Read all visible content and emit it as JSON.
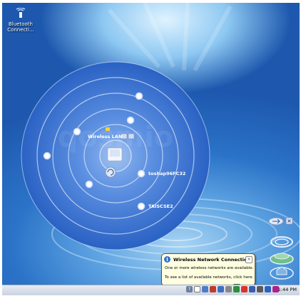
{
  "desktop": {
    "icon_label_line1": "Bluetooth",
    "icon_label_line2": "Connecti..."
  },
  "radar": {
    "center_label": "Wireless LAN",
    "network_1": "toshap96FC32",
    "network_2": "TAISCSE2"
  },
  "balloon": {
    "title": "Wireless Network Connection",
    "message": "One or more wireless networks are available.",
    "action": "To see a list of available networks, click here.",
    "close": "×"
  },
  "taskbar": {
    "clock": "1:44 PM"
  },
  "colors": {
    "radar_outer": "#2f67c8",
    "radar_inner": "#5b8fe0",
    "balloon_bg": "#fffee1"
  }
}
